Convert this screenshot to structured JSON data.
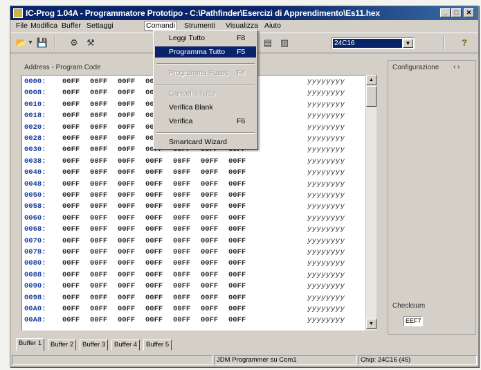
{
  "window": {
    "title": "IC-Prog 1.04A - Programmatore Prototipo - C:\\Pathfinder\\Esercizi di Apprendimento\\Es11.hex",
    "btn_min": "_",
    "btn_max": "□",
    "btn_close": "✕"
  },
  "menubar": [
    "File",
    "Modifica",
    "Buffer",
    "Settaggi",
    "Comandi",
    "Strumenti",
    "Visualizza",
    "Aiuto"
  ],
  "toolbar": {
    "icons": [
      "open-folder-icon",
      "dropdown-arrow-icon",
      "save-disk-icon",
      "chip-read-icon",
      "chip-settings-icon",
      "read-icon",
      "program-icon"
    ],
    "glyphs": [
      "📂",
      "▾",
      "💾",
      "⚙",
      "⚒",
      "▤",
      "▥"
    ],
    "device": "24C16",
    "help_glyph": "?"
  },
  "panel": {
    "address_label": "Address - Program Code",
    "config_label": "Configurazione",
    "config_arrows": "‹ ›",
    "checksum_label": "Checksum",
    "checksum_value": "EEF7"
  },
  "grid": {
    "rows": [
      {
        "addr": "0000:",
        "cells": [
          "00FF",
          "00FF",
          "00FF",
          "00FF",
          "00FF",
          "00FF",
          "00FF"
        ],
        "ascii": "yyyyyyyy"
      },
      {
        "addr": "0008:",
        "cells": [
          "00FF",
          "00FF",
          "00FF",
          "00FF",
          "00FF",
          "00FF",
          "00FF"
        ],
        "ascii": "yyyyyyyy"
      },
      {
        "addr": "0010:",
        "cells": [
          "00FF",
          "00FF",
          "00FF",
          "00FF",
          "00FF",
          "00FF",
          "00FF"
        ],
        "ascii": "yyyyyyyy"
      },
      {
        "addr": "0018:",
        "cells": [
          "00FF",
          "00FF",
          "00FF",
          "00FF",
          "00FF",
          "00FF",
          "00FF"
        ],
        "ascii": "yyyyyyyy"
      },
      {
        "addr": "0020:",
        "cells": [
          "00FF",
          "00FF",
          "00FF",
          "00FF",
          "00FF",
          "00FF",
          "00FF"
        ],
        "ascii": "yyyyyyyy"
      },
      {
        "addr": "0028:",
        "cells": [
          "00FF",
          "00FF",
          "00FF",
          "00FF",
          "00FF",
          "00FF",
          "00FF"
        ],
        "ascii": "yyyyyyyy"
      },
      {
        "addr": "0030:",
        "cells": [
          "00FF",
          "00FF",
          "00FF",
          "00FF",
          "00FF",
          "00FF",
          "00FF"
        ],
        "ascii": "yyyyyyyy"
      },
      {
        "addr": "0038:",
        "cells": [
          "00FF",
          "00FF",
          "00FF",
          "00FF",
          "00FF",
          "00FF",
          "00FF"
        ],
        "ascii": "yyyyyyyy"
      },
      {
        "addr": "0040:",
        "cells": [
          "00FF",
          "00FF",
          "00FF",
          "00FF",
          "00FF",
          "00FF",
          "00FF"
        ],
        "ascii": "yyyyyyyy"
      },
      {
        "addr": "0048:",
        "cells": [
          "00FF",
          "00FF",
          "00FF",
          "00FF",
          "00FF",
          "00FF",
          "00FF"
        ],
        "ascii": "yyyyyyyy"
      },
      {
        "addr": "0050:",
        "cells": [
          "00FF",
          "00FF",
          "00FF",
          "00FF",
          "00FF",
          "00FF",
          "00FF"
        ],
        "ascii": "yyyyyyyy"
      },
      {
        "addr": "0058:",
        "cells": [
          "00FF",
          "00FF",
          "00FF",
          "00FF",
          "00FF",
          "00FF",
          "00FF"
        ],
        "ascii": "yyyyyyyy"
      },
      {
        "addr": "0060:",
        "cells": [
          "00FF",
          "00FF",
          "00FF",
          "00FF",
          "00FF",
          "00FF",
          "00FF"
        ],
        "ascii": "yyyyyyyy"
      },
      {
        "addr": "0068:",
        "cells": [
          "00FF",
          "00FF",
          "00FF",
          "00FF",
          "00FF",
          "00FF",
          "00FF"
        ],
        "ascii": "yyyyyyyy"
      },
      {
        "addr": "0070:",
        "cells": [
          "00FF",
          "00FF",
          "00FF",
          "00FF",
          "00FF",
          "00FF",
          "00FF"
        ],
        "ascii": "yyyyyyyy"
      },
      {
        "addr": "0078:",
        "cells": [
          "00FF",
          "00FF",
          "00FF",
          "00FF",
          "00FF",
          "00FF",
          "00FF"
        ],
        "ascii": "yyyyyyyy"
      },
      {
        "addr": "0080:",
        "cells": [
          "00FF",
          "00FF",
          "00FF",
          "00FF",
          "00FF",
          "00FF",
          "00FF"
        ],
        "ascii": "yyyyyyyy"
      },
      {
        "addr": "0088:",
        "cells": [
          "00FF",
          "00FF",
          "00FF",
          "00FF",
          "00FF",
          "00FF",
          "00FF"
        ],
        "ascii": "yyyyyyyy"
      },
      {
        "addr": "0090:",
        "cells": [
          "00FF",
          "00FF",
          "00FF",
          "00FF",
          "00FF",
          "00FF",
          "00FF"
        ],
        "ascii": "yyyyyyyy"
      },
      {
        "addr": "0098:",
        "cells": [
          "00FF",
          "00FF",
          "00FF",
          "00FF",
          "00FF",
          "00FF",
          "00FF"
        ],
        "ascii": "yyyyyyyy"
      },
      {
        "addr": "00A0:",
        "cells": [
          "00FF",
          "00FF",
          "00FF",
          "00FF",
          "00FF",
          "00FF",
          "00FF"
        ],
        "ascii": "yyyyyyyy"
      },
      {
        "addr": "00A8:",
        "cells": [
          "00FF",
          "00FF",
          "00FF",
          "00FF",
          "00FF",
          "00FF",
          "00FF"
        ],
        "ascii": "yyyyyyyy"
      }
    ]
  },
  "comandi_menu": {
    "items": [
      {
        "label": "Leggi Tutto",
        "shortcut": "F8",
        "state": "normal"
      },
      {
        "label": "Programma Tutto",
        "shortcut": "F5",
        "state": "highlighted"
      },
      {
        "separator": true
      },
      {
        "label": "Programma Fuses",
        "shortcut": "F4",
        "state": "disabled"
      },
      {
        "separator": true
      },
      {
        "label": "Cancella Tutto",
        "shortcut": "",
        "state": "disabled"
      },
      {
        "label": "Verifica Blank",
        "shortcut": "",
        "state": "normal"
      },
      {
        "label": "Verifica",
        "shortcut": "F6",
        "state": "normal"
      },
      {
        "separator": true
      },
      {
        "label": "Smartcard Wizard",
        "shortcut": "",
        "state": "normal"
      }
    ]
  },
  "tabs": [
    "Buffer 1",
    "Buffer 2",
    "Buffer 3",
    "Buffer 4",
    "Buffer 5"
  ],
  "status": {
    "pane1": "",
    "pane2": "JDM Programmer su Com1",
    "pane3": "Chip: 24C16  (45)"
  },
  "colors": {
    "titlebar": "#0a246a",
    "highlight": "#0a246a",
    "address_text": "#1a3fa0",
    "face": "#d4d0c8"
  }
}
